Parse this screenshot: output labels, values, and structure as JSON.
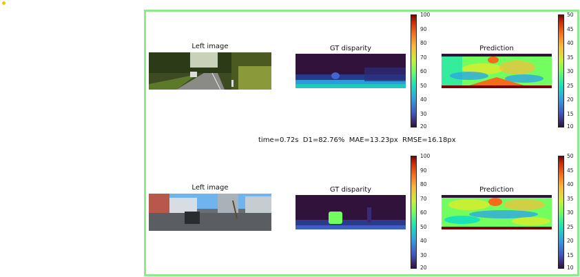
{
  "top_row": {
    "left_title": "Left image",
    "gt_title": "GT disparity",
    "pred_title": "Prediction",
    "gt_colorbar_ticks": [
      "100",
      "90",
      "80",
      "70",
      "60",
      "50",
      "40",
      "30",
      "20"
    ],
    "pred_colorbar_ticks": [
      "50",
      "45",
      "40",
      "35",
      "30",
      "25",
      "20",
      "15",
      "10"
    ]
  },
  "bottom_row": {
    "left_title": "Left image",
    "gt_title": "GT disparity",
    "pred_title": "Prediction",
    "gt_colorbar_ticks": [
      "100",
      "90",
      "80",
      "70",
      "60",
      "50",
      "40",
      "30",
      "20"
    ],
    "pred_colorbar_ticks": [
      "50",
      "45",
      "40",
      "35",
      "30",
      "25",
      "20",
      "15",
      "10"
    ]
  },
  "metrics": {
    "text": "time=0.72s  D1=82.76%  MAE=13.23px  RMSE=16.18px"
  },
  "colors": {
    "frame_border": "#8ee88e",
    "status_dot": "#f5c400"
  },
  "icons": {
    "status_dot": "status-dot-icon"
  }
}
